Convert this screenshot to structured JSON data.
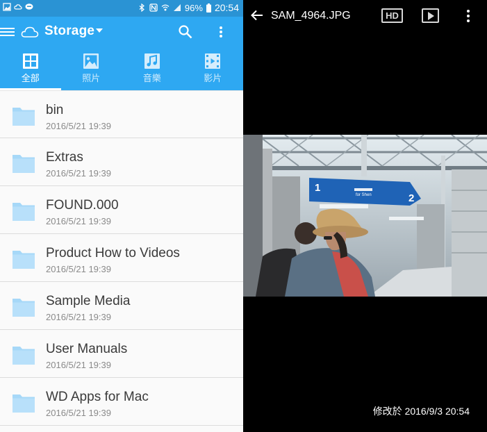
{
  "status_bar": {
    "battery": "96%",
    "time": "20:54"
  },
  "app_bar": {
    "title": "Storage"
  },
  "tabs": [
    {
      "label": "全部",
      "icon": "all-files-icon",
      "active": true
    },
    {
      "label": "照片",
      "icon": "photo-icon",
      "active": false
    },
    {
      "label": "音樂",
      "icon": "music-icon",
      "active": false
    },
    {
      "label": "影片",
      "icon": "video-icon",
      "active": false
    }
  ],
  "files": [
    {
      "name": "bin",
      "date": "2016/5/21 19:39"
    },
    {
      "name": "Extras",
      "date": "2016/5/21 19:39"
    },
    {
      "name": "FOUND.000",
      "date": "2016/5/21 19:39"
    },
    {
      "name": "Product How to Videos",
      "date": "2016/5/21 19:39"
    },
    {
      "name": "Sample Media",
      "date": "2016/5/21 19:39"
    },
    {
      "name": "User Manuals",
      "date": "2016/5/21 19:39"
    },
    {
      "name": "WD Apps for Mac",
      "date": "2016/5/21 19:39"
    }
  ],
  "viewer": {
    "filename": "SAM_4964.JPG",
    "hd_label": "HD",
    "modified": "修改於 2016/9/3 20:54"
  },
  "photo_sign": {
    "left_number": "1",
    "right_number": "2",
    "text": "for Shen"
  },
  "colors": {
    "app_bar": "#2ea8f2",
    "status_bar": "#2a93d4",
    "folder": "#a6d8f8"
  }
}
